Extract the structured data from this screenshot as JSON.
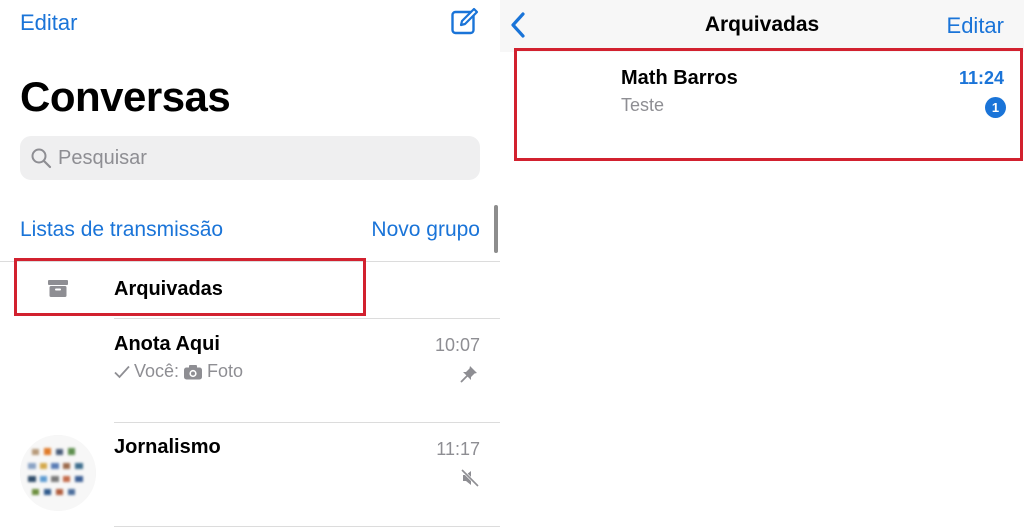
{
  "left": {
    "edit_label": "Editar",
    "title": "Conversas",
    "search_placeholder": "Pesquisar",
    "broadcast_label": "Listas de transmissão",
    "new_group_label": "Novo grupo",
    "archived_label": "Arquivadas",
    "chats": [
      {
        "name": "Anota Aqui",
        "time": "10:07",
        "sender": "Você:",
        "preview": "Foto",
        "status_icon": "pin-icon"
      },
      {
        "name": "Jornalismo",
        "time": "11:17",
        "status_icon": "muted-icon"
      }
    ]
  },
  "right": {
    "back_icon": "chevron-left-icon",
    "title": "Arquivadas",
    "edit_label": "Editar",
    "chat": {
      "name": "Math Barros",
      "preview": "Teste",
      "time": "11:24",
      "unread": "1"
    }
  },
  "colors": {
    "accent": "#1a74d8",
    "highlight": "#d2212f",
    "secondary_text": "#8e8e93"
  }
}
